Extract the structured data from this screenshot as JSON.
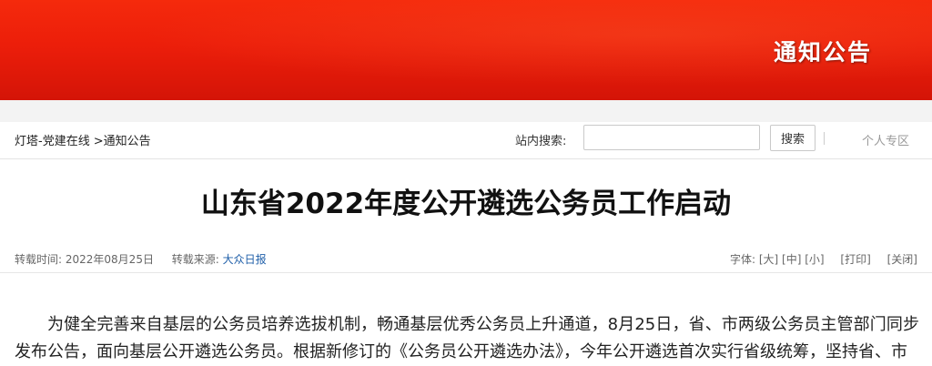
{
  "header": {
    "section_title": "通知公告"
  },
  "nav": {
    "breadcrumb": {
      "home": "灯塔-党建在线",
      "current": ">通知公告"
    },
    "search": {
      "label": "站内搜索:",
      "value": "",
      "placeholder": "",
      "button_label": "搜索"
    },
    "personal_label": "个人专区"
  },
  "article": {
    "title": "山东省2022年度公开遴选公务员工作启动",
    "meta": {
      "time_label": "转载时间:",
      "time_value": "2022年08月25日",
      "source_label": "转载来源:",
      "source_value": "大众日报"
    },
    "tools": {
      "font_label": "字体:",
      "large": "[大]",
      "medium": "[中]",
      "small": "[小]",
      "print": "[打印]",
      "close": "[关闭]"
    },
    "body": "为健全完善来自基层的公务员培养选拔机制，畅通基层优秀公务员上升通道，8月25日，省、市两级公务员主管部门同步发布公告，面向基层公开遴选公务员。根据新修订的《公务员公开遴选办法》，今年公开遴选首次实行省级统筹，坚持省、市"
  },
  "colors": {
    "banner_red": "#ec1e0a",
    "link_blue": "#1f5fa9"
  }
}
